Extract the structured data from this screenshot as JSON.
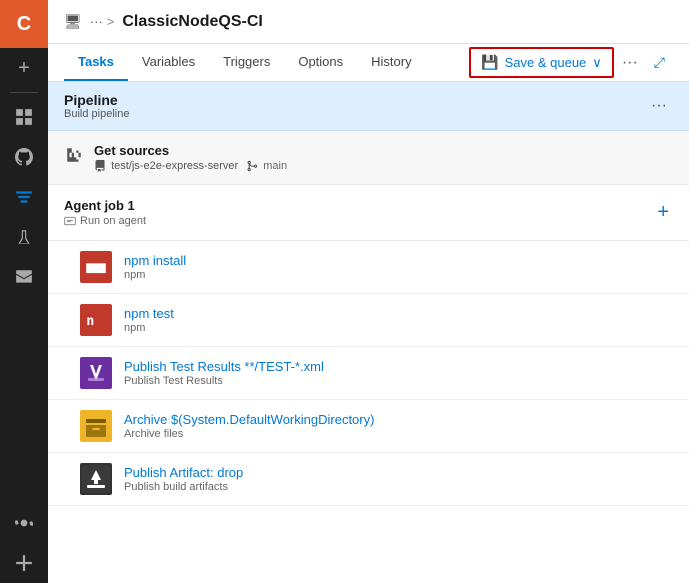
{
  "sidebar": {
    "logo": "C",
    "icons": [
      {
        "name": "overview",
        "symbol": "⊞"
      },
      {
        "name": "add",
        "symbol": "+"
      },
      {
        "name": "boards",
        "symbol": "▦"
      },
      {
        "name": "repos",
        "symbol": "⎇"
      },
      {
        "name": "pipelines",
        "symbol": "▷"
      },
      {
        "name": "test-plans",
        "symbol": "🧪"
      },
      {
        "name": "artifacts",
        "symbol": "📦"
      },
      {
        "name": "project-settings",
        "symbol": "⚙"
      }
    ]
  },
  "topbar": {
    "icon": "🖥",
    "breadcrumb_more": "···",
    "separator": ">",
    "title": "ClassicNodeQS-CI"
  },
  "nav": {
    "tabs": [
      {
        "id": "tasks",
        "label": "Tasks",
        "active": true
      },
      {
        "id": "variables",
        "label": "Variables"
      },
      {
        "id": "triggers",
        "label": "Triggers"
      },
      {
        "id": "options",
        "label": "Options"
      },
      {
        "id": "history",
        "label": "History"
      }
    ],
    "save_queue_label": "Save & queue",
    "save_queue_dropdown": "∨",
    "more": "···",
    "external_link": "⤢"
  },
  "pipeline": {
    "title": "Pipeline",
    "subtitle": "Build pipeline",
    "more": "···"
  },
  "get_sources": {
    "title": "Get sources",
    "repo": "test/js-e2e-express-server",
    "branch": "main"
  },
  "agent_job": {
    "title": "Agent job 1",
    "subtitle": "Run on agent",
    "add_label": "+"
  },
  "tasks": [
    {
      "id": "npm-install",
      "icon_type": "npm",
      "icon_text": "n",
      "title": "npm install",
      "subtitle": "npm"
    },
    {
      "id": "npm-test",
      "icon_type": "npm",
      "icon_text": "n",
      "title": "npm test",
      "subtitle": "npm"
    },
    {
      "id": "publish-test-results",
      "icon_type": "test-results",
      "icon_emoji": "🧪",
      "title": "Publish Test Results **/TEST-*.xml",
      "subtitle": "Publish Test Results"
    },
    {
      "id": "archive",
      "icon_type": "archive",
      "icon_emoji": "🗜",
      "title": "Archive $(System.DefaultWorkingDirectory)",
      "subtitle": "Archive files"
    },
    {
      "id": "publish-artifact",
      "icon_type": "publish",
      "icon_emoji": "⬆",
      "title": "Publish Artifact: drop",
      "subtitle": "Publish build artifacts"
    }
  ]
}
